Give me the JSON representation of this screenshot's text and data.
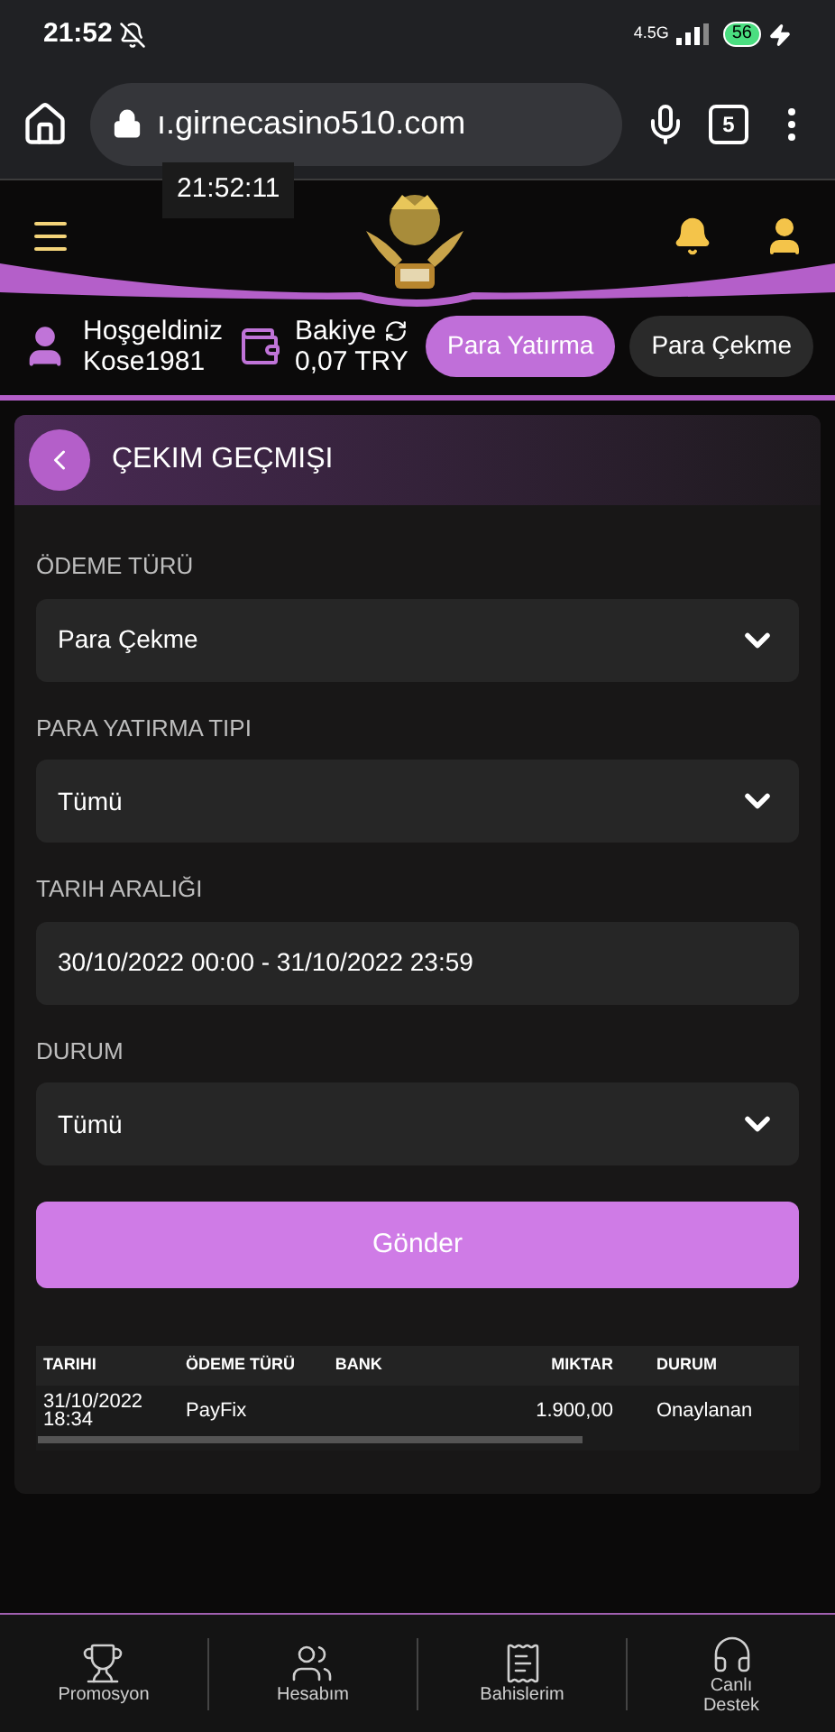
{
  "status_bar": {
    "time": "21:52",
    "network": "4.5G",
    "battery": "56"
  },
  "browser": {
    "url": "ı.girnecasino510.com",
    "tab_count": "5",
    "tooltip": "21:52:11"
  },
  "user": {
    "greeting": "Hoşgeldiniz",
    "username": "Kose1981",
    "balance_label": "Bakiye",
    "balance": "0,07 TRY"
  },
  "actions": [
    {
      "label": "Para Yatırma",
      "selected": true
    },
    {
      "label": "Para Çekme",
      "selected": false
    }
  ],
  "card": {
    "title": "ÇEKIM GEÇMIŞI"
  },
  "fields": [
    {
      "label": "ÖDEME TÜRÜ",
      "value": "Para Çekme",
      "kind": "select"
    },
    {
      "label": "PARA YATIRMA TIPI",
      "value": "Tümü",
      "kind": "select"
    },
    {
      "label": "TARIH ARALIĞI",
      "value": "30/10/2022 00:00 - 31/10/2022 23:59",
      "kind": "text"
    },
    {
      "label": "DURUM",
      "value": "Tümü",
      "kind": "select"
    }
  ],
  "submit": "Gönder",
  "table": {
    "columns": [
      "TARIHI",
      "ÖDEME TÜRÜ",
      "BANK",
      "MIKTAR",
      "DURUM"
    ],
    "rows": [
      [
        "31/10/2022\n18:34",
        "PayFix",
        "",
        "1.900,00",
        "Onaylanan"
      ]
    ]
  },
  "bottom_nav": [
    {
      "label": "Promosyon",
      "kind": "trophy"
    },
    {
      "label": "Hesabım",
      "kind": "users"
    },
    {
      "label": "Bahislerim",
      "kind": "receipt"
    },
    {
      "label": "Canlı\nDestek",
      "kind": "headset"
    }
  ]
}
